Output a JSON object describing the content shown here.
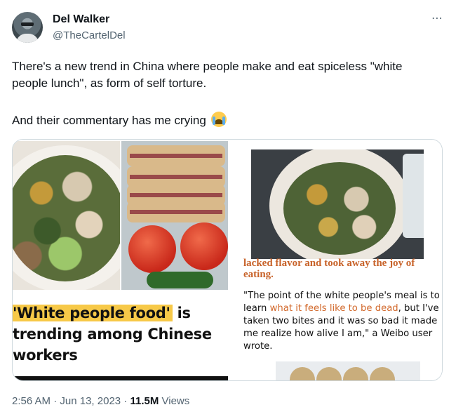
{
  "author": {
    "display_name": "Del Walker",
    "handle": "@TheCartelDel"
  },
  "more_icon": "⋯",
  "tweet": {
    "line1": "There's a new trend in China where people make and eat spiceless \"white people lunch\", as form of self torture.",
    "line2": "And their commentary has me crying",
    "emoji": "loudly-crying-face"
  },
  "media": {
    "left": {
      "headline_highlight": "'White people food'",
      "headline_rest_1": " is",
      "headline_rest_2": "trending among Chinese",
      "headline_rest_3": "workers"
    },
    "right": {
      "cut_line": "lacked flavor and took away the joy of",
      "cut_line_end": "eating.",
      "quote_a": "\"The point of the white people's meal is to learn ",
      "quote_orange": "what it feels like to be dead",
      "quote_b": ", but I've taken two bites and it was so bad it made me realize how alive I am,\" a Weibo user wrote."
    }
  },
  "footer": {
    "time": "2:56 AM",
    "sep1": " · ",
    "date": "Jun 13, 2023",
    "sep2": " · ",
    "views_count": "11.5M",
    "views_label": " Views"
  },
  "colors": {
    "text": "#0f1419",
    "secondary": "#536471",
    "highlight": "#f7c948",
    "orange": "#d2692c"
  }
}
